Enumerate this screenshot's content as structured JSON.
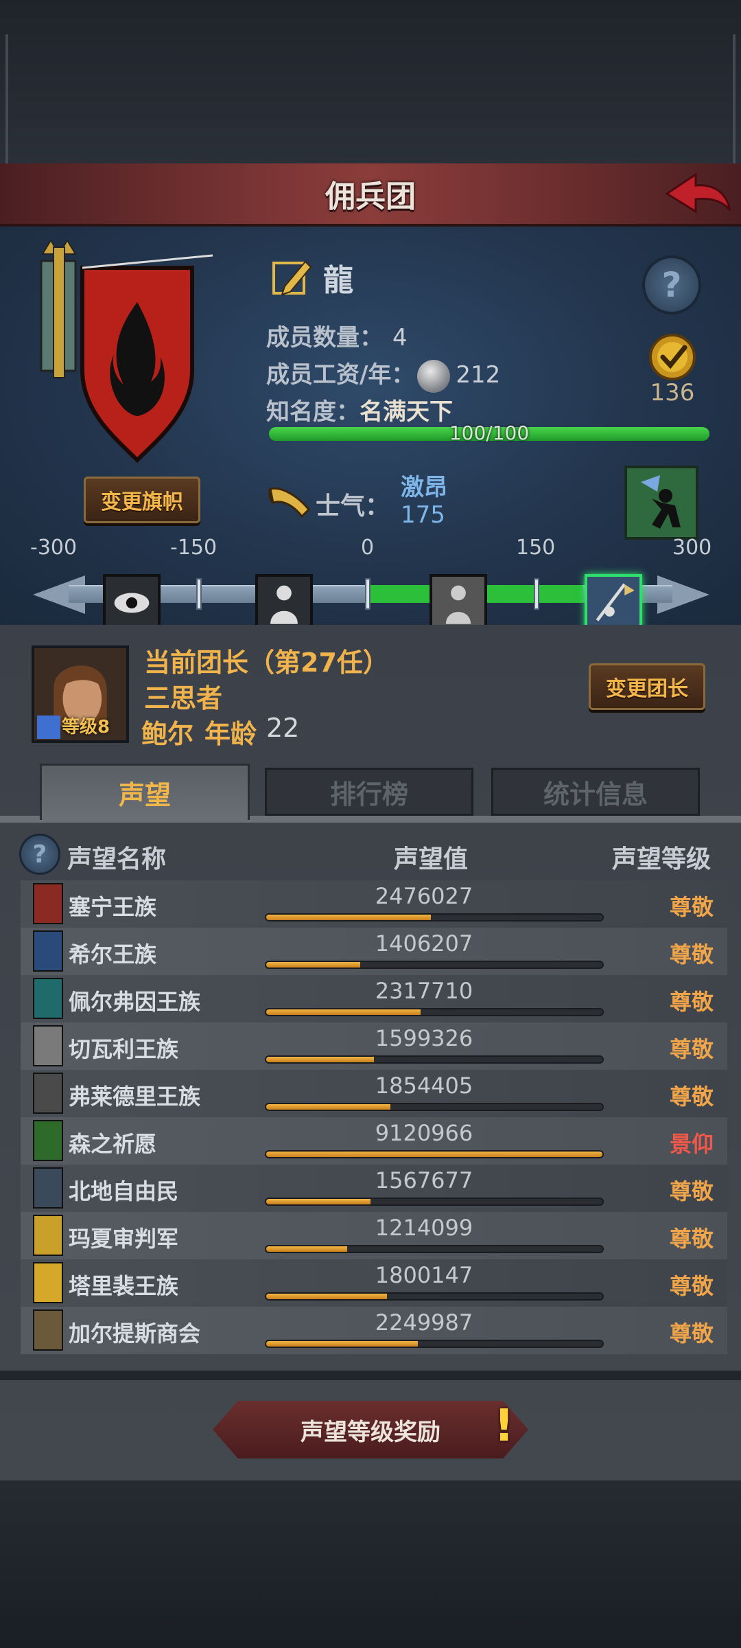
{
  "header": {
    "title": "佣兵团"
  },
  "guild": {
    "name": "龍",
    "member_count_label": "成员数量：",
    "member_count": "4",
    "salary_label": "成员工资/年：",
    "salary": "212",
    "fame_label": "知名度：",
    "fame_title": "名满天下",
    "fame_progress_text": "100/100",
    "fame_progress": 1.0,
    "medal_value": "136",
    "change_flag_label": "变更旗帜"
  },
  "morale": {
    "label": "士气：",
    "state": "激昂",
    "value": "175",
    "scale_ticks": [
      "-300",
      "-150",
      "0",
      "150",
      "300"
    ]
  },
  "leader": {
    "title": "当前团长（第27任）",
    "trait": "三思者",
    "name": "鲍尔",
    "age_label": "年龄",
    "age": "22",
    "level_label": "等级8",
    "change_leader_label": "变更团长"
  },
  "tabs": [
    {
      "label": "声望"
    },
    {
      "label": "排行榜"
    },
    {
      "label": "统计信息"
    }
  ],
  "reputation": {
    "col_name": "声望名称",
    "col_value": "声望值",
    "col_level": "声望等级",
    "rows": [
      {
        "name": "塞宁王族",
        "value": "2476027",
        "level": "尊敬",
        "progress": 0.49,
        "crest_color": "#8a2a22"
      },
      {
        "name": "希尔王族",
        "value": "1406207",
        "level": "尊敬",
        "progress": 0.28,
        "crest_color": "#2a4a7a"
      },
      {
        "name": "佩尔弗因王族",
        "value": "2317710",
        "level": "尊敬",
        "progress": 0.46,
        "crest_color": "#1f6a6a"
      },
      {
        "name": "切瓦利王族",
        "value": "1599326",
        "level": "尊敬",
        "progress": 0.32,
        "crest_color": "#7a7a7a"
      },
      {
        "name": "弗莱德里王族",
        "value": "1854405",
        "level": "尊敬",
        "progress": 0.37,
        "crest_color": "#4a4a4a"
      },
      {
        "name": "森之祈愿",
        "value": "9120966",
        "level": "景仰",
        "progress": 1.0,
        "crest_color": "#2e6a2a"
      },
      {
        "name": "北地自由民",
        "value": "1567677",
        "level": "尊敬",
        "progress": 0.31,
        "crest_color": "#3a4a5a"
      },
      {
        "name": "玛夏审判军",
        "value": "1214099",
        "level": "尊敬",
        "progress": 0.24,
        "crest_color": "#c9a12a"
      },
      {
        "name": "塔里裴王族",
        "value": "1800147",
        "level": "尊敬",
        "progress": 0.36,
        "crest_color": "#d6a82a"
      },
      {
        "name": "加尔提斯商会",
        "value": "2249987",
        "level": "尊敬",
        "progress": 0.45,
        "crest_color": "#6a5a3a"
      }
    ]
  },
  "colors": {
    "level_respect": "#f1a54a",
    "level_revere": "#f0584a"
  },
  "reward_button_label": "声望等级奖励"
}
